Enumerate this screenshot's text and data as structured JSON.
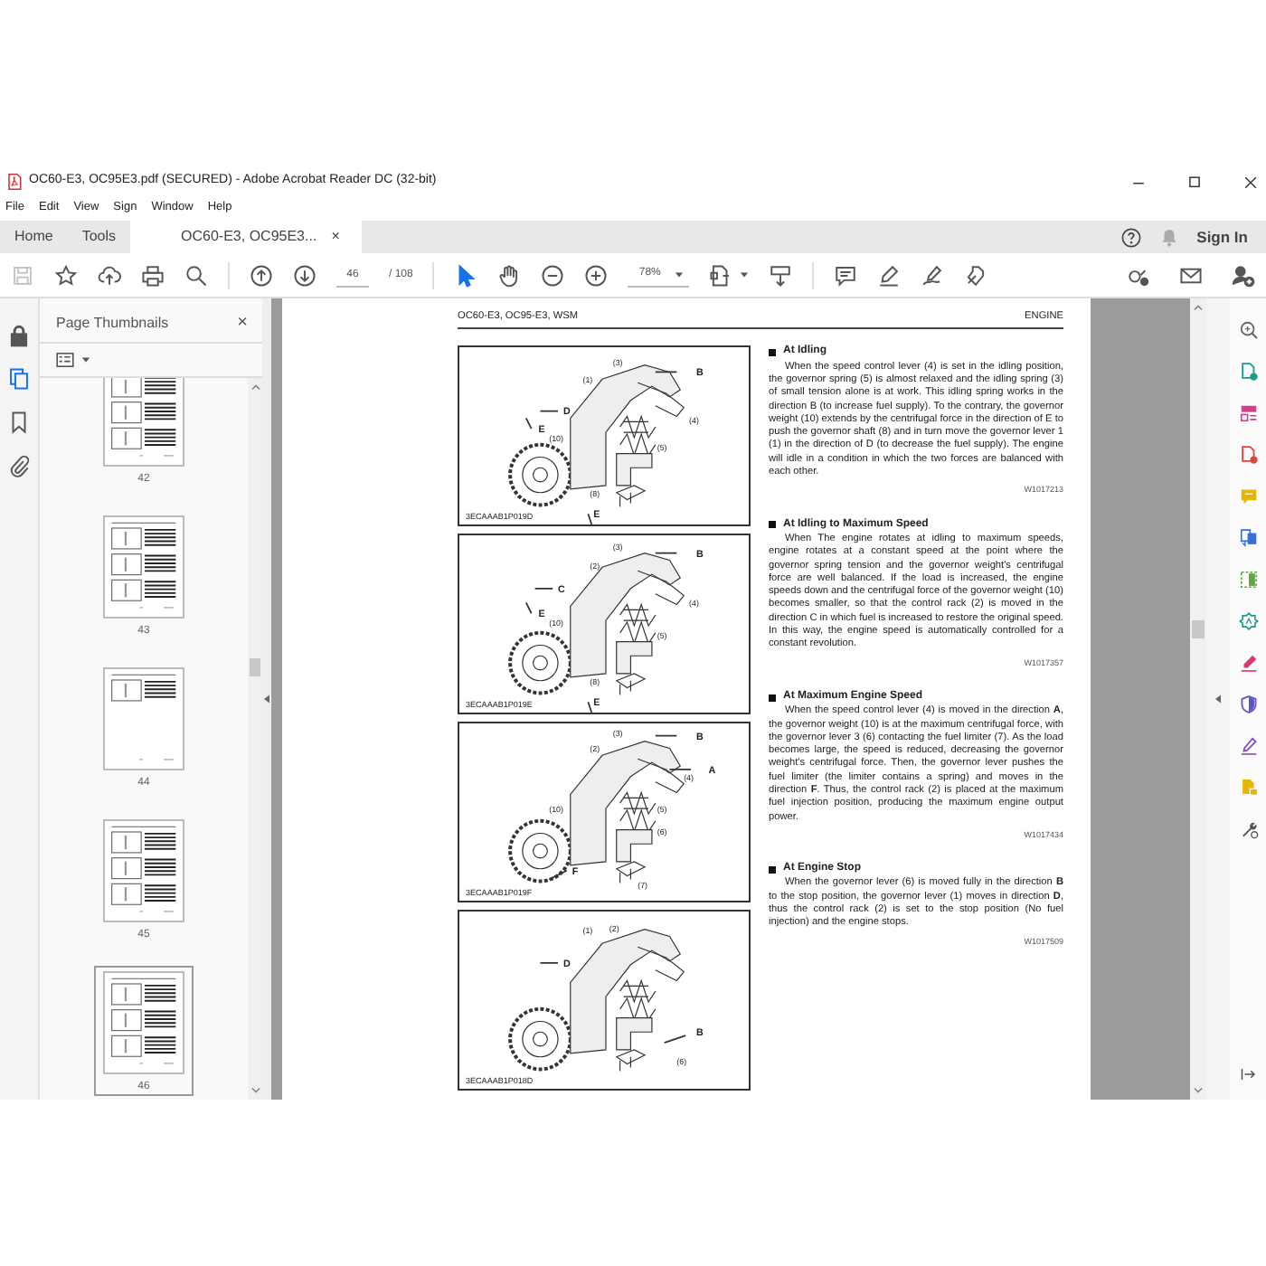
{
  "window": {
    "title": "OC60-E3, OC95E3.pdf (SECURED) - Adobe Acrobat Reader DC (32-bit)"
  },
  "menu": [
    "File",
    "Edit",
    "View",
    "Sign",
    "Window",
    "Help"
  ],
  "tabs": [
    {
      "label": "Home",
      "selected": false,
      "kind": "nav"
    },
    {
      "label": "Tools",
      "selected": false,
      "kind": "nav"
    },
    {
      "label": "OC60-E3, OC95E3...",
      "selected": true,
      "kind": "doc",
      "close": "×"
    }
  ],
  "account": {
    "sign_in": "Sign In"
  },
  "toolbar": {
    "left": [
      {
        "kind": "save",
        "disabled": true
      },
      {
        "kind": "star"
      },
      {
        "kind": "upload"
      },
      {
        "kind": "print"
      },
      {
        "kind": "search"
      },
      {
        "kind": "separator"
      },
      {
        "kind": "page_up"
      },
      {
        "kind": "page_down"
      },
      {
        "kind": "page_field",
        "value": "46"
      },
      {
        "kind": "page_total",
        "text": "/ 108"
      },
      {
        "kind": "separator"
      },
      {
        "kind": "cursor",
        "selected": true
      },
      {
        "kind": "hand",
        "selected": false
      },
      {
        "kind": "zoom_out"
      },
      {
        "kind": "zoom_in"
      },
      {
        "kind": "zoom_field",
        "value": "78%"
      },
      {
        "kind": "fit"
      },
      {
        "kind": "scroll"
      },
      {
        "kind": "separator"
      },
      {
        "kind": "comment"
      },
      {
        "kind": "highlight"
      },
      {
        "kind": "sign"
      },
      {
        "kind": "stamp"
      }
    ],
    "right": [
      {
        "kind": "share"
      },
      {
        "kind": "mail"
      },
      {
        "kind": "add_user"
      }
    ]
  },
  "side_rail": [
    {
      "kind": "lock",
      "selected": false
    },
    {
      "kind": "pages",
      "selected": true
    },
    {
      "kind": "bookmark",
      "selected": false
    },
    {
      "kind": "attachment",
      "selected": false
    }
  ],
  "thumbnails_panel": {
    "title": "Page Thumbnails",
    "close": "×",
    "pages": [
      {
        "label": "42",
        "selected": false
      },
      {
        "label": "43",
        "selected": false
      },
      {
        "label": "44",
        "selected": false
      },
      {
        "label": "45",
        "selected": false
      },
      {
        "label": "46",
        "selected": true
      }
    ]
  },
  "document": {
    "header_left": "OC60-E3, OC95-E3, WSM",
    "header_right": "ENGINE",
    "figures": [
      {
        "caption": "3ECAAAB1P019D",
        "callouts": [
          "(3)",
          "B",
          "(1)",
          "D",
          "(4)",
          "E",
          "(10)",
          "(5)",
          "(8)",
          "E"
        ]
      },
      {
        "caption": "3ECAAAB1P019E",
        "callouts": [
          "(3)",
          "B",
          "(2)",
          "C",
          "(4)",
          "E",
          "(10)",
          "(5)",
          "(8)",
          "E"
        ]
      },
      {
        "caption": "3ECAAAB1P019F",
        "callouts": [
          "(3)",
          "B",
          "(2)",
          "A",
          "(4)",
          "(10)",
          "(5)",
          "(6)",
          "F",
          "(7)"
        ]
      },
      {
        "caption": "3ECAAAB1P018D",
        "callouts": [
          "(1)",
          "(2)",
          "D",
          "B",
          "(6)"
        ]
      }
    ],
    "sections": [
      {
        "heading": "At Idling",
        "body": "When the speed control lever (4) is set in the idling position, the governor spring (5) is almost relaxed and the idling spring (3) of small tension alone is at work. This idling spring works in the direction B (to increase fuel supply). To the contrary, the governor weight (10) extends by the centrifugal force in the direction of E to push the governor shaft (8) and in turn move the governor lever 1 (1) in the direction of D (to decrease the fuel supply). The engine will idle in a condition in which the two forces are balanced with each other.",
        "code": "W1017213"
      },
      {
        "heading": "At Idling to Maximum Speed",
        "body": "When The engine rotates at idling to maximum speeds, engine rotates at a constant speed at the point where the governor spring tension and the governor weight's centrifugal force are well balanced. If the load is increased, the engine speeds down and the centrifugal force of the governor weight (10) becomes smaller, so that the control rack (2) is moved in the direction C in which fuel is increased to restore the original speed. In this way, the engine speed is automatically controlled for a constant revolution.",
        "code": "W1017357"
      },
      {
        "heading": "At Maximum Engine Speed",
        "body": "When the speed control lever (4) is moved in the direction **A**, the governor weight (10) is at the maximum centrifugal force, with the governor lever 3 (6) contacting the fuel limiter (7). As the load becomes large, the speed is reduced, decreasing the governor weight's centrifugal force. Then, the governor lever pushes the fuel limiter (the limiter contains a spring) and moves in the direction **F**. Thus, the control rack (2) is placed at the maximum fuel injection position, producing the maximum engine output power.",
        "code": "W1017434"
      },
      {
        "heading": "At Engine Stop",
        "body": "When the governor lever (6) is moved fully in the direction **B** to the stop position, the governor lever (1) moves in direction **D**, thus the control rack (2) is set to the stop position (No fuel injection) and the engine stops.",
        "code": "W1017509"
      }
    ]
  },
  "tools_rail": [
    {
      "kind": "zoom"
    },
    {
      "kind": "export"
    },
    {
      "kind": "organize"
    },
    {
      "kind": "create"
    },
    {
      "kind": "comment"
    },
    {
      "kind": "convert"
    },
    {
      "kind": "crop"
    },
    {
      "kind": "gear_doc"
    },
    {
      "kind": "fill_sign"
    },
    {
      "kind": "protect"
    },
    {
      "kind": "signature"
    },
    {
      "kind": "send"
    },
    {
      "kind": "more"
    }
  ]
}
